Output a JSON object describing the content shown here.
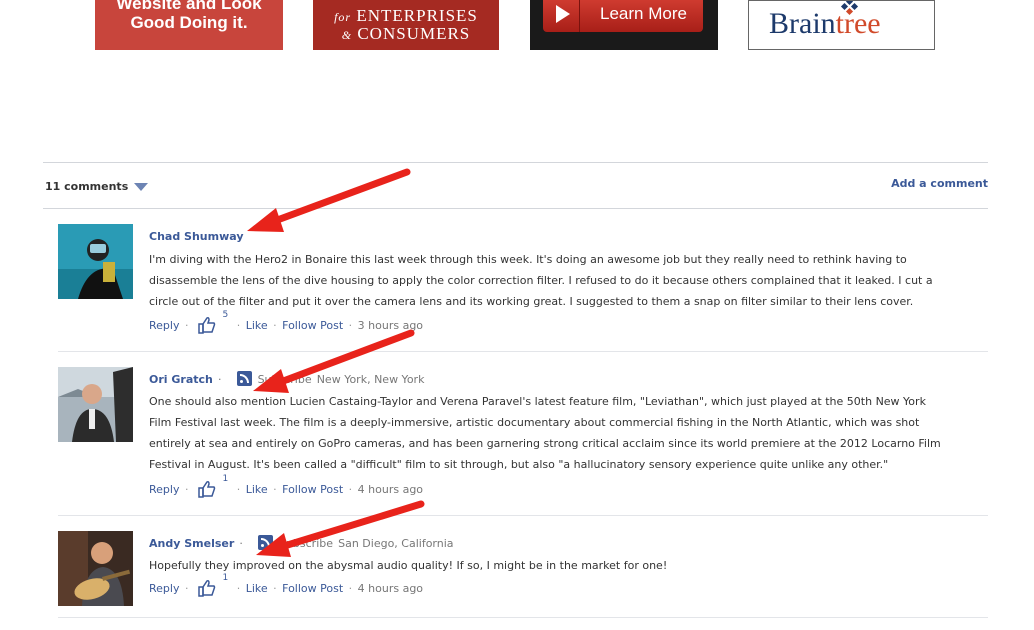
{
  "ads": {
    "ad1": {
      "line1": "Website and Look",
      "line2": "Good Doing it."
    },
    "ad2": {
      "line1_prefix": "for",
      "line1": "ENTERPRISES",
      "line2_prefix": "&",
      "line2": "CONSUMERS"
    },
    "ad3": {
      "button": "Learn More"
    },
    "ad4": {
      "brand_a": "Brain",
      "brand_b": "tree"
    }
  },
  "comments_header": {
    "count": "11 comments",
    "add_comment": "Add a comment"
  },
  "actions": {
    "reply": "Reply",
    "like": "Like",
    "follow": "Follow Post",
    "dot": "·"
  },
  "comments": [
    {
      "author": "Chad Shumway",
      "subscribe": "",
      "location": "",
      "text": "I'm diving with the Hero2 in Bonaire this last week through this week. It's doing an awesome job but they really need to rethink having to disassemble the lens of the dive housing to apply the color correction filter. I refused to do it because others complained that it leaked. I cut a circle out of the filter and put it over the camera lens and its working great. I suggested to them a snap on filter similar to their lens cover.",
      "likes": "5",
      "time": "3 hours ago"
    },
    {
      "author": "Ori Gratch",
      "subscribe": "Subscribe",
      "location": "New York, New York",
      "text": "One should also mention Lucien Castaing-Taylor and Verena Paravel's latest feature film, \"Leviathan\", which just played at the 50th New York Film Festival last week. The film is a deeply-immersive, artistic documentary about commercial fishing in the North Atlantic, which was shot entirely at sea and entirely on GoPro cameras, and has been garnering strong critical acclaim since its world premiere at the 2012 Locarno Film Festival in August. It's been called a \"difficult\" film to sit through, but also \"a hallucinatory sensory experience quite unlike any other.\"",
      "likes": "1",
      "time": "4 hours ago"
    },
    {
      "author": "Andy Smelser",
      "subscribe": "Subscribe",
      "location": "San Diego, California",
      "text": "Hopefully they improved on the abysmal audio quality! If so, I might be in the market for one!",
      "likes": "1",
      "time": "4 hours ago"
    }
  ],
  "colors": {
    "link": "#3b5998",
    "arrow": "#e8231b"
  }
}
